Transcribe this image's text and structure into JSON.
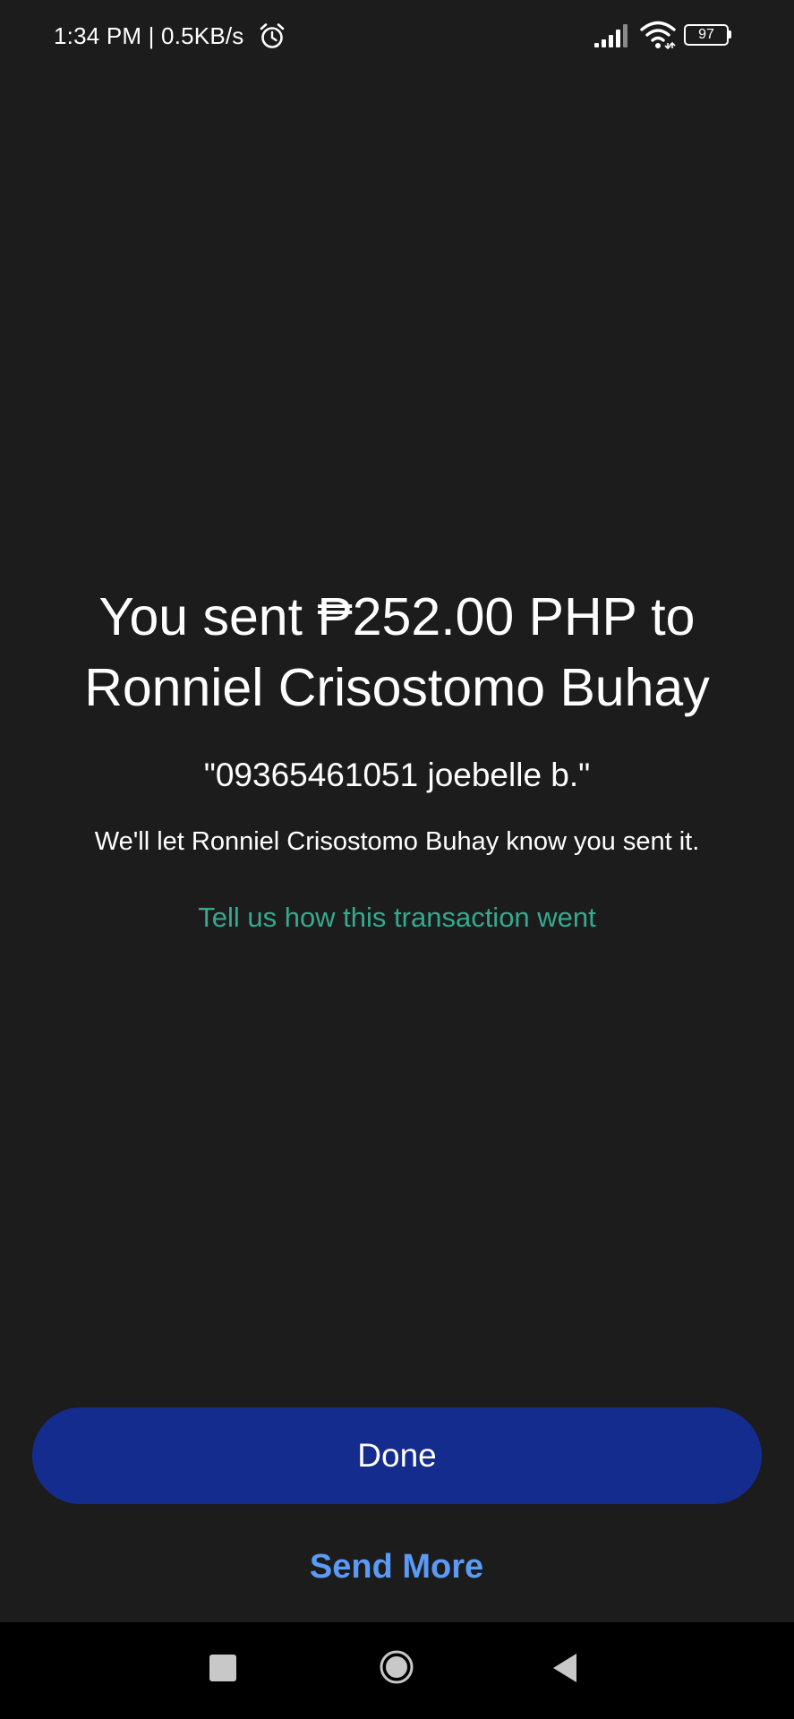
{
  "status_bar": {
    "time_speed": "1:34 PM | 0.5KB/s",
    "alarm_icon": "alarm-clock-icon",
    "signal_icon": "cell-signal-icon",
    "wifi_icon": "wifi-icon",
    "battery_level": "97"
  },
  "confirmation": {
    "headline": "You sent ₱252.00 PHP to Ronniel Crisostomo Buhay",
    "note": "\"09365461051 joebelle b.\"",
    "notify_text": "We'll let Ronniel Crisostomo Buhay know you sent it.",
    "feedback_link": "Tell us how this transaction went"
  },
  "actions": {
    "done_label": "Done",
    "send_more_label": "Send More"
  },
  "nav_bar": {
    "recents_icon": "square-recents-icon",
    "home_icon": "circle-home-icon",
    "back_icon": "triangle-back-icon"
  },
  "colors": {
    "background": "#1c1c1c",
    "done_button": "#142c8e",
    "send_more": "#5b9af5",
    "feedback_link": "#36a98f",
    "nav_bar": "#000000"
  }
}
